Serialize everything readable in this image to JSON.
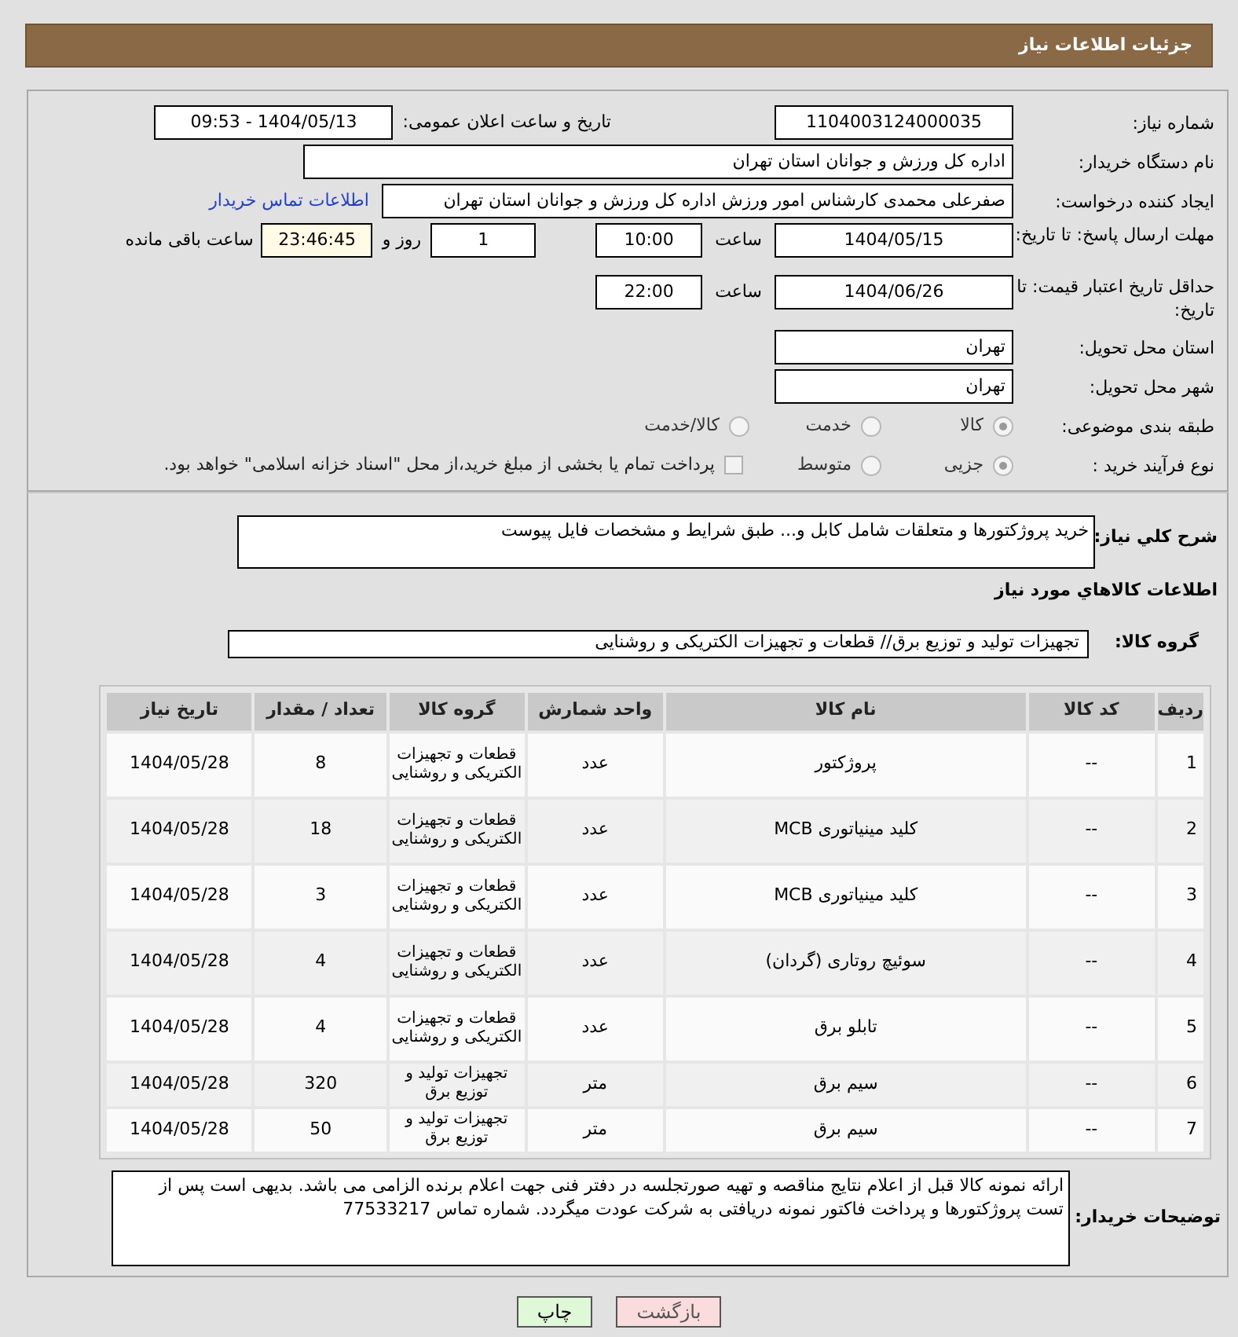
{
  "header": {
    "title": "جزئیات اطلاعات نیاز"
  },
  "need_number": {
    "label": "شماره نیاز:",
    "value": "1104003124000035"
  },
  "announce_datetime": {
    "label": "تاریخ و ساعت اعلان عمومی:",
    "value": "1404/05/13 - 09:53"
  },
  "buyer_org": {
    "label": "نام دستگاه خریدار:",
    "value": "اداره کل ورزش و جوانان استان تهران"
  },
  "requester": {
    "label": "ایجاد کننده درخواست:",
    "value": "صفرعلی محمدی کارشناس امور ورزش اداره کل ورزش و جوانان استان تهران",
    "link": "اطلاعات تماس خریدار"
  },
  "response_deadline": {
    "label": "مهلت ارسال پاسخ: تا تاریخ:",
    "date": "1404/05/15",
    "time_label": "ساعت",
    "time": "10:00",
    "days": "1",
    "days_label": "روز و",
    "remaining": "23:46:45",
    "remaining_label": "ساعت باقی مانده"
  },
  "price_validity": {
    "label": "حداقل تاریخ اعتبار قیمت: تا تاریخ:",
    "date": "1404/06/26",
    "time_label": "ساعت",
    "time": "22:00"
  },
  "delivery_province": {
    "label": "استان محل تحویل:",
    "value": "تهران"
  },
  "delivery_city": {
    "label": "شهر محل تحویل:",
    "value": "تهران"
  },
  "category": {
    "label": "طبقه بندی موضوعی:",
    "options": [
      {
        "label": "کالا",
        "selected": true
      },
      {
        "label": "خدمت",
        "selected": false
      },
      {
        "label": "کالا/خدمت",
        "selected": false
      }
    ]
  },
  "process": {
    "label": "نوع فرآیند خرید :",
    "options": [
      {
        "label": "جزیی",
        "selected": true
      },
      {
        "label": "متوسط",
        "selected": false
      }
    ],
    "checkbox": {
      "label": "پرداخت تمام یا بخشی از مبلغ خرید،از محل \"اسناد خزانه اسلامی\" خواهد بود.",
      "checked": false
    }
  },
  "description": {
    "label": "شرح کلي نياز:",
    "value": "خرید پروژکتورها و متعلقات شامل کابل و... طبق شرایط و مشخصات فایل پیوست"
  },
  "items_heading": "اطلاعات کالاهاي مورد نياز",
  "goods_group": {
    "label": "گروه کالا:",
    "value": "تجهیزات تولید و توزیع برق// قطعات و تجهیزات الکتریکی و روشنایی"
  },
  "table": {
    "columns": [
      "ردیف",
      "کد کالا",
      "نام کالا",
      "واحد شمارش",
      "گروه کالا",
      "تعداد / مقدار",
      "تاریخ نیاز"
    ],
    "rows": [
      [
        "1",
        "--",
        "پروژکتور",
        "عدد",
        "قطعات و تجهیزات الکتریکی و روشنایی",
        "8",
        "1404/05/28"
      ],
      [
        "2",
        "--",
        "کلید مینیاتوری MCB",
        "عدد",
        "قطعات و تجهیزات الکتریکی و روشنایی",
        "18",
        "1404/05/28"
      ],
      [
        "3",
        "--",
        "کلید مینیاتوری MCB",
        "عدد",
        "قطعات و تجهیزات الکتریکی و روشنایی",
        "3",
        "1404/05/28"
      ],
      [
        "4",
        "--",
        "سوئیچ روتاری (گردان)",
        "عدد",
        "قطعات و تجهیزات الکتریکی و روشنایی",
        "4",
        "1404/05/28"
      ],
      [
        "5",
        "--",
        "تابلو برق",
        "عدد",
        "قطعات و تجهیزات الکتریکی و روشنایی",
        "4",
        "1404/05/28"
      ],
      [
        "6",
        "--",
        "سیم برق",
        "متر",
        "تجهیزات تولید و توزیع برق",
        "320",
        "1404/05/28"
      ],
      [
        "7",
        "--",
        "سیم برق",
        "متر",
        "تجهیزات تولید و توزیع برق",
        "50",
        "1404/05/28"
      ]
    ]
  },
  "buyer_notes": {
    "label": "توضیحات خریدار:",
    "value": "ارائه نمونه کالا قبل از اعلام نتایج مناقصه و تهیه صورتجلسه در دفتر فنی جهت اعلام برنده الزامی می باشد. بدیهی است پس از تست پروژکتورها و پرداخت فاکتور نمونه دریافتی به شرکت عودت میگردد.  شماره تماس  77533217"
  },
  "buttons": [
    {
      "label": "بازگشت",
      "kind": "back"
    },
    {
      "label": "چاپ",
      "kind": "print"
    }
  ]
}
